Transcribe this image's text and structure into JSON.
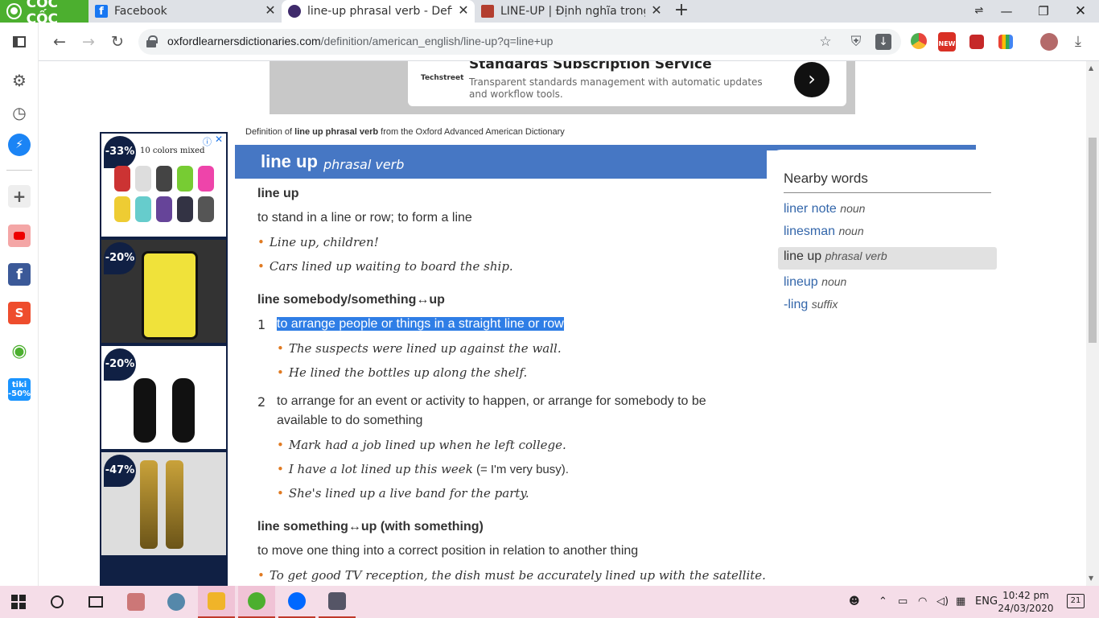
{
  "browser": {
    "brand": "CỐC CỐC",
    "tabs": [
      {
        "title": "Facebook",
        "color": "#1877f2"
      },
      {
        "title": "line-up phrasal verb - Definiti",
        "color": "#3f2a6b"
      },
      {
        "title": "LINE-UP | Định nghĩa trong Ti",
        "color": "#b33e2f"
      }
    ],
    "url_host": "oxfordlearnersdictionaries.com",
    "url_path": "/definition/american_english/line-up?q=line+up",
    "ext_new": "NEW"
  },
  "sidebar": {
    "tiki": "tiki -50%"
  },
  "banner": {
    "logo": "Techstreet",
    "title": "Standards Subscription Service",
    "desc": "Transparent standards management with automatic updates and workflow tools."
  },
  "side_ad": {
    "cells": [
      {
        "discount": "-33%",
        "caption": "10 colors mixed"
      },
      {
        "discount": "-20%",
        "caption": ""
      },
      {
        "discount": "-20%",
        "caption": ""
      },
      {
        "discount": "-47%",
        "caption": ""
      }
    ]
  },
  "entry": {
    "source_prefix": "Definition of ",
    "source_word": "line up phrasal verb",
    "source_suffix": " from the Oxford Advanced American Dictionary",
    "headword": "line up",
    "pos": "phrasal verb",
    "senses": [
      {
        "head": "line up",
        "def": "to stand in a line or row; to form a line",
        "examples": [
          "Line up, children!",
          "Cars lined up waiting to board the ship."
        ]
      },
      {
        "head": "line somebody/something↔up",
        "subs": [
          {
            "num": "1",
            "def": "to arrange people or things in a straight line or row",
            "examples": [
              "The suspects were lined up against the wall.",
              "He lined the bottles up along the shelf."
            ]
          },
          {
            "num": "2",
            "def_line1": "to arrange for an event or activity to happen, or arrange for somebody to be",
            "def_line2": "available to do something",
            "examples": [
              "Mark had a job lined up when he left college.",
              "I have a lot lined up this week",
              "She's lined up a live band for the party."
            ],
            "gloss": " (= I'm very busy)."
          }
        ]
      },
      {
        "head": "line something↔up (with something)",
        "def": "to move one thing into a correct position in relation to another thing",
        "examples": [
          "To get good TV reception, the dish must be accurately lined up with the satellite."
        ]
      }
    ]
  },
  "nearby": {
    "title": "Nearby words",
    "items": [
      {
        "word": "liner note",
        "pos": "noun"
      },
      {
        "word": "linesman",
        "pos": "noun"
      },
      {
        "word": "line up",
        "pos": "phrasal verb"
      },
      {
        "word": "lineup",
        "pos": "noun"
      },
      {
        "word": "-ling",
        "pos": "suffix"
      }
    ]
  },
  "taskbar": {
    "lang": "ENG",
    "time": "10:42 pm",
    "date": "24/03/2020",
    "notif": "21"
  }
}
